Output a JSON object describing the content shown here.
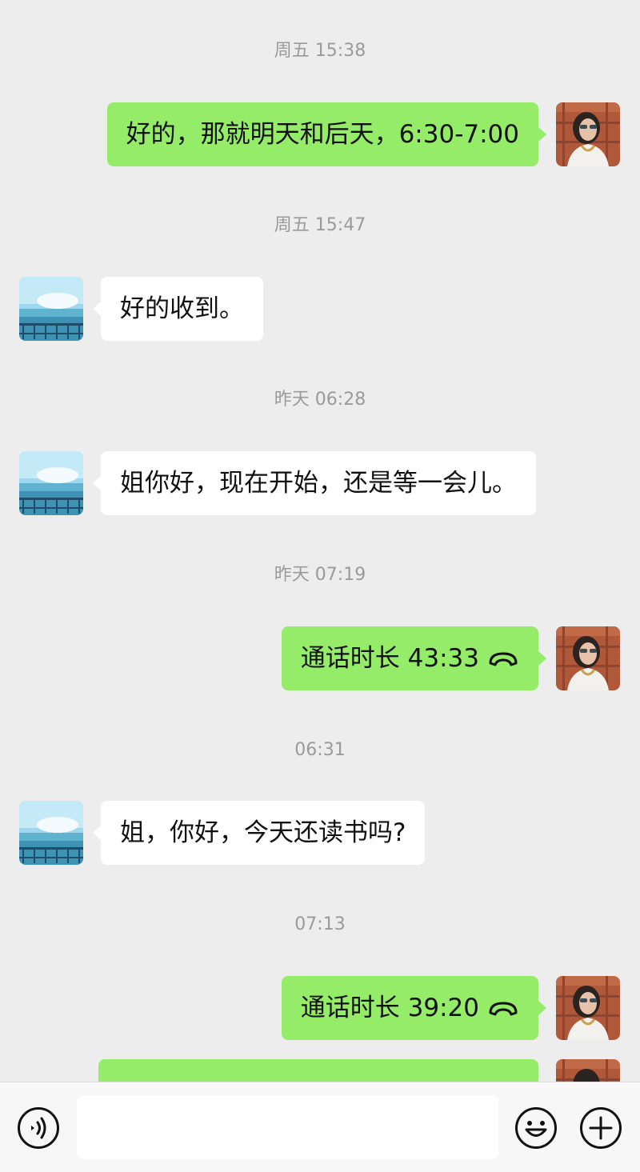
{
  "messages": [
    {
      "kind": "time",
      "text": "周五 15:38"
    },
    {
      "kind": "sent",
      "text": "好的，那就明天和后天，6:30-7:00"
    },
    {
      "kind": "time",
      "text": "周五 15:47"
    },
    {
      "kind": "recv",
      "text": "好的收到。"
    },
    {
      "kind": "time",
      "text": "昨天 06:28"
    },
    {
      "kind": "recv",
      "text": "姐你好，现在开始，还是等一会儿。"
    },
    {
      "kind": "time",
      "text": "昨天 07:19"
    },
    {
      "kind": "sent_call",
      "text": "通话时长 43:33"
    },
    {
      "kind": "time",
      "text": "06:31"
    },
    {
      "kind": "recv",
      "text": "姐，你好，今天还读书吗?"
    },
    {
      "kind": "time",
      "text": "07:13"
    },
    {
      "kind": "sent_call",
      "text": "通话时长 39:20"
    }
  ],
  "toolbar": {
    "voice_icon": "voice-icon",
    "emoji_icon": "emoji-icon",
    "more_icon": "plus-icon",
    "input_value": ""
  },
  "colors": {
    "background": "#ededed",
    "sent_bubble": "#95ec69",
    "received_bubble": "#ffffff",
    "timestamp": "#9a9a9a"
  }
}
